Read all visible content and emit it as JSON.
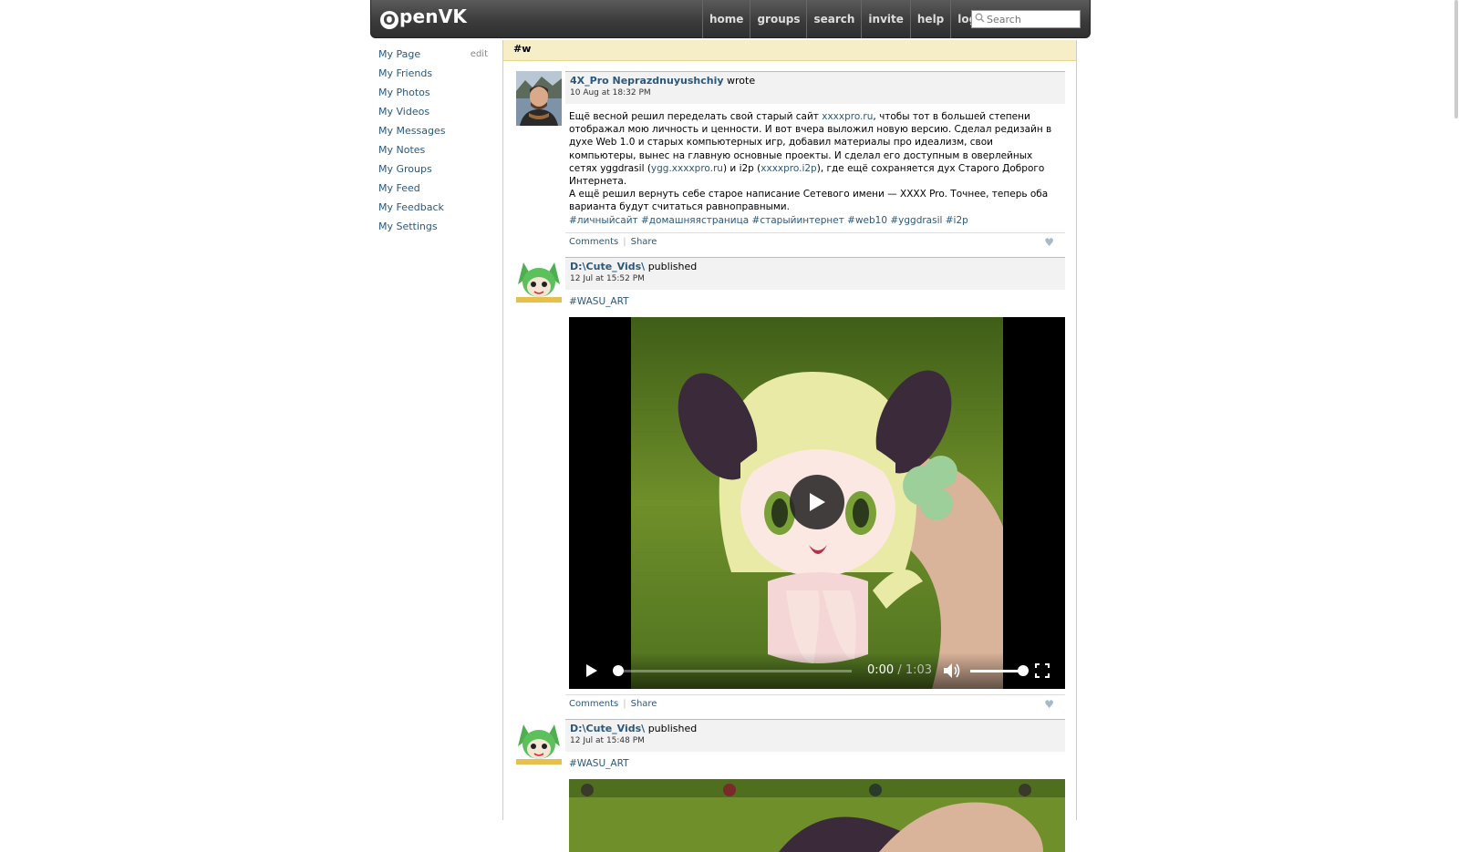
{
  "header": {
    "logo": "penVK",
    "logo_letter": "O",
    "nav": [
      "home",
      "groups",
      "search",
      "invite",
      "help",
      "log out"
    ],
    "search_placeholder": "Search"
  },
  "sidebar": {
    "items": [
      {
        "label": "My Page",
        "extra": "edit"
      },
      {
        "label": "My Friends"
      },
      {
        "label": "My Photos"
      },
      {
        "label": "My Videos"
      },
      {
        "label": "My Messages"
      },
      {
        "label": "My Notes"
      },
      {
        "label": "My Groups"
      },
      {
        "label": "My Feed"
      },
      {
        "label": "My Feedback"
      },
      {
        "label": "My Settings"
      }
    ]
  },
  "page": {
    "hashtag_title": "#w"
  },
  "posts": [
    {
      "author": "4X_Pro Neprazdnuyushchiy",
      "verb": "wrote",
      "date": "10 Aug at 18:32 PM",
      "text_1a": "Ещё весной решил переделать свой старый сайт ",
      "link_1": "xxxxpro.ru",
      "text_1b": ", чтобы тот в большей степени отображал мою личность и ценности. И вот вчера выложил новую версию. Сделал редизайн в духе Web 1.0 и старых компьютерных игр, добавил материалы про идеализм, свои компьютеры, вынес на главную основные проекты. И сделал его доступным в оверлейных сетях yggdrasil (",
      "link_2": "ygg.xxxxpro.ru",
      "text_1c": ") и i2p (",
      "link_3": "xxxxpro.i2p",
      "text_1d": "), где ещё сохраняется дух Старого Доброго Интернета.",
      "text_2": "А ещё решил вернуть себе старое написание Сетевого имени — XXXX Pro. Точнее, теперь оба варианта будут считаться равноправными.",
      "hashtags": "#личныйсайт #домашняястраница #старыйинтернет #web10 #yggdrasil #i2p",
      "comments": "Comments",
      "share": "Share"
    },
    {
      "author": "D:\\Cute_Vids\\",
      "verb": "published",
      "date": "12 Jul at 15:52 PM",
      "hashtags": "#WASU_ART",
      "video": {
        "current_time": "0:00",
        "separator": "/",
        "duration": "1:03",
        "progress": 0,
        "volume": 1.0
      },
      "comments": "Comments",
      "share": "Share"
    },
    {
      "author": "D:\\Cute_Vids\\",
      "verb": "published",
      "date": "12 Jul at 15:48 PM",
      "hashtags": "#WASU_ART"
    }
  ],
  "colors": {
    "link": "#2b587a",
    "header_bg": "#3a3a3a",
    "tag_bar": "#f5eec6",
    "like_heart": "#a6b8cc"
  }
}
